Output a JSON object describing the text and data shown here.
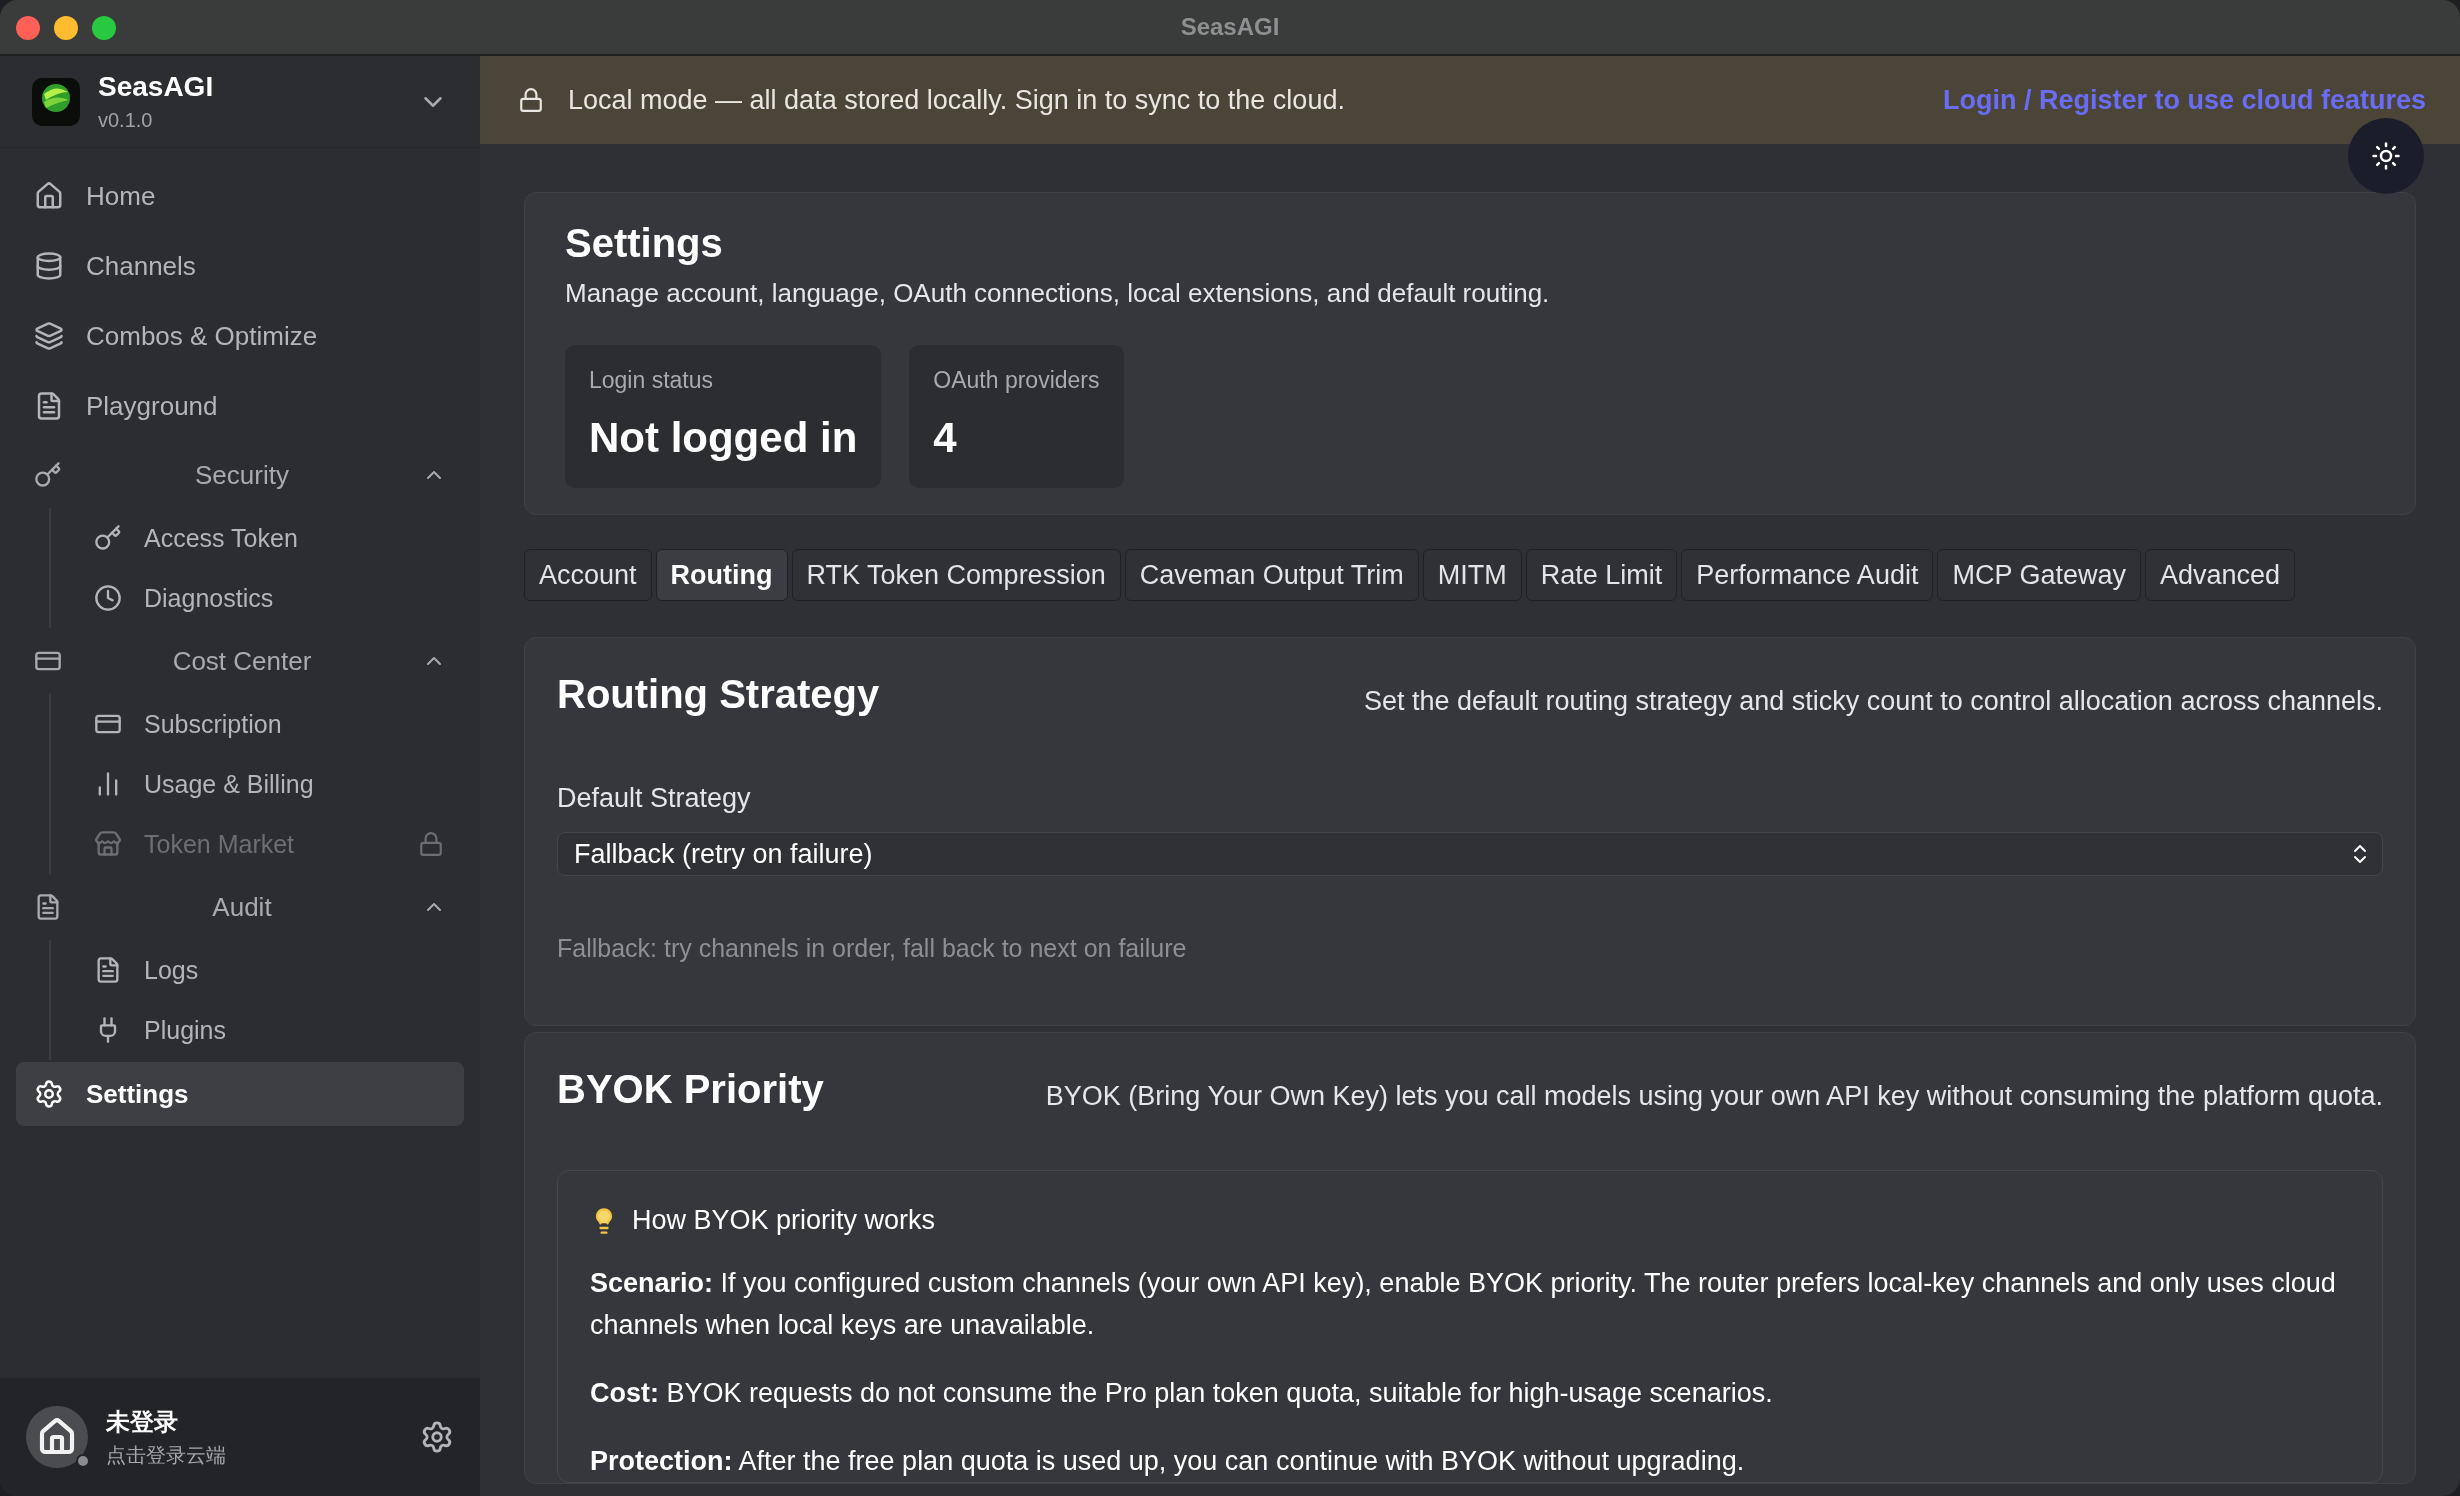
{
  "window": {
    "title": "SeasAGI"
  },
  "app": {
    "name": "SeasAGI",
    "version": "v0.1.0"
  },
  "sidebar": {
    "items": [
      {
        "kind": "link",
        "label": "Home",
        "selected": false
      },
      {
        "kind": "link",
        "label": "Channels",
        "selected": false
      },
      {
        "kind": "link",
        "label": "Combos & Optimize",
        "selected": false
      },
      {
        "kind": "link",
        "label": "Playground",
        "selected": false
      },
      {
        "kind": "group",
        "label": "Security",
        "expanded": true,
        "children": [
          {
            "label": "Access Token",
            "locked": false,
            "selected": false
          },
          {
            "label": "Diagnostics",
            "locked": false,
            "selected": false
          }
        ]
      },
      {
        "kind": "group",
        "label": "Cost Center",
        "expanded": true,
        "children": [
          {
            "label": "Subscription",
            "locked": false,
            "selected": false
          },
          {
            "label": "Usage & Billing",
            "locked": false,
            "selected": false
          },
          {
            "label": "Token Market",
            "locked": true,
            "selected": false
          }
        ]
      },
      {
        "kind": "group",
        "label": "Audit",
        "expanded": true,
        "children": [
          {
            "label": "Logs",
            "locked": false,
            "selected": false
          },
          {
            "label": "Plugins",
            "locked": false,
            "selected": false
          }
        ]
      },
      {
        "kind": "link",
        "label": "Settings",
        "selected": true
      }
    ]
  },
  "user": {
    "name": "未登录",
    "hint": "点击登录云端"
  },
  "banner": {
    "message": "Local mode — all data stored locally. Sign in to sync to the cloud.",
    "link": "Login / Register to use cloud features"
  },
  "page": {
    "title": "Settings",
    "subtitle": "Manage account, language, OAuth connections, local extensions, and default routing.",
    "stats": [
      {
        "label": "Login status",
        "value": "Not logged in"
      },
      {
        "label": "OAuth providers",
        "value": "4"
      }
    ]
  },
  "tabs": [
    {
      "label": "Account",
      "selected": false
    },
    {
      "label": "Routing",
      "selected": true
    },
    {
      "label": "RTK Token Compression",
      "selected": false
    },
    {
      "label": "Caveman Output Trim",
      "selected": false
    },
    {
      "label": "MITM",
      "selected": false
    },
    {
      "label": "Rate Limit",
      "selected": false
    },
    {
      "label": "Performance Audit",
      "selected": false
    },
    {
      "label": "MCP Gateway",
      "selected": false
    },
    {
      "label": "Advanced",
      "selected": false
    }
  ],
  "routing": {
    "title": "Routing Strategy",
    "description": "Set the default routing strategy and sticky count to control allocation across channels.",
    "field_label": "Default Strategy",
    "value": "Fallback (retry on failure)",
    "hint": "Fallback: try channels in order, fall back to next on failure"
  },
  "byok": {
    "title": "BYOK Priority",
    "description": "BYOK (Bring Your Own Key) lets you call models using your own API key without consuming the platform quota.",
    "info": {
      "title": "How BYOK priority works",
      "paragraphs": [
        "**Scenario:** If you configured custom channels (your own API key), enable BYOK priority. The router prefers local-key channels and only uses cloud channels when local keys are unavailable.",
        "**Cost:** BYOK requests do not consume the Pro plan token quota, suitable for high-usage scenarios.",
        "**Protection:** After the free plan quota is used up, you can continue with BYOK without upgrading."
      ]
    }
  }
}
